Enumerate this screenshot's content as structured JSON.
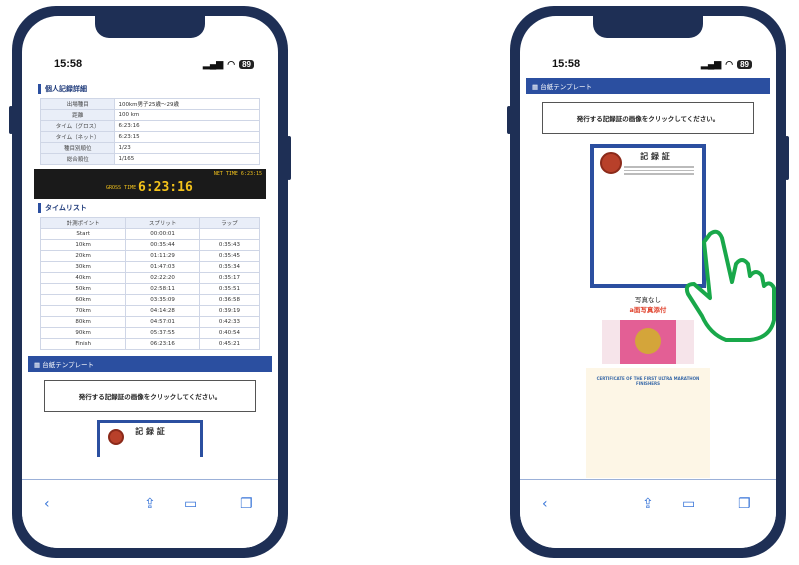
{
  "left": {
    "time": "15:58",
    "battery": "89",
    "detail_title": "個人記録詳細",
    "details": [
      {
        "k": "出場種目",
        "v": "100km男子25歳〜29歳"
      },
      {
        "k": "距離",
        "v": "100 km"
      },
      {
        "k": "タイム（グロス）",
        "v": "6:23:16"
      },
      {
        "k": "タイム（ネット）",
        "v": "6:23:15"
      },
      {
        "k": "種目別順位",
        "v": "1/23"
      },
      {
        "k": "総合順位",
        "v": "1/165"
      }
    ],
    "net_time": "NET TIME  6:23:15",
    "gross_label": "GROSS TIME",
    "gross_value": "6:23:16",
    "timelist_title": "タイムリスト",
    "lap_headers": [
      "計測ポイント",
      "スプリット",
      "ラップ"
    ],
    "laps": [
      [
        "Start",
        "00:00:01",
        ""
      ],
      [
        "10km",
        "00:35:44",
        "0:35:43"
      ],
      [
        "20km",
        "01:11:29",
        "0:35:45"
      ],
      [
        "30km",
        "01:47:03",
        "0:35:34"
      ],
      [
        "40km",
        "02:22:20",
        "0:35:17"
      ],
      [
        "50km",
        "02:58:11",
        "0:35:51"
      ],
      [
        "60km",
        "03:35:09",
        "0:36:58"
      ],
      [
        "70km",
        "04:14:28",
        "0:39:19"
      ],
      [
        "80km",
        "04:57:01",
        "0:42:33"
      ],
      [
        "90km",
        "05:37:55",
        "0:40:54"
      ],
      [
        "Finish",
        "06:23:16",
        "0:45:21"
      ]
    ],
    "template_bar": "台紙テンプレート",
    "message": "発行する記録証の画像をクリックしてください。",
    "cert_title": "記 録 証"
  },
  "right": {
    "time": "15:58",
    "battery": "89",
    "template_bar": "台紙テンプレート",
    "message": "発行する記録証の画像をクリックしてください。",
    "cert_title": "記 録 証",
    "caption": "写真なし",
    "caption2": "a面写真添付",
    "cert3_title": "CERTIFICATE OF THE FIRST ULTRA MARATHON FINISHERS"
  },
  "colors": {
    "frame": "#1e2f55",
    "accent": "#2b4fa0",
    "hand": "#19a84a"
  }
}
